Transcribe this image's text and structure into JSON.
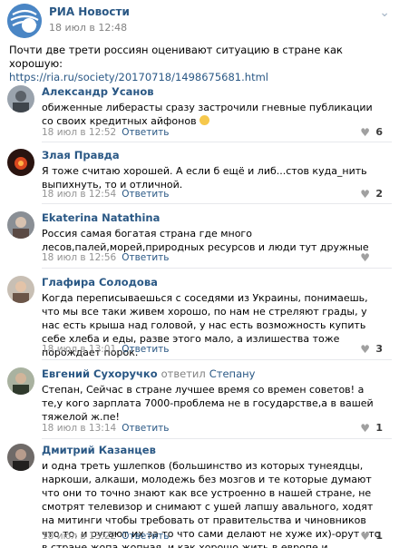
{
  "post": {
    "author": "РИА Новости",
    "date": "18 июл в 12:48",
    "text": "Почти две трети россиян оценивают ситуацию в стране как хорошую:",
    "link": "https://ria.ru/society/20170718/1498675681.html",
    "menu_icon": "chevron-down-icon"
  },
  "comments": [
    {
      "author": "Александр Усанов",
      "text": "обиженные либерасты сразу застрочили гневные публикации со своих кредитных айфонов",
      "date": "18 июл в 12:52",
      "reply_label": "Ответить",
      "likes": "6"
    },
    {
      "author": "Злая Правда",
      "text": "Я тоже считаю хорошей. А если б ещё и либ...стов куда_нить выпихнуть, то и отличной.",
      "date": "18 июл в 12:54",
      "reply_label": "Ответить",
      "likes": "2"
    },
    {
      "author": "Ekaterina Natathina",
      "text": "Россия самая богатая страна где много лесов,палей,морей,природных ресурсов и люди тут дружные",
      "date": "18 июл в 12:56",
      "reply_label": "Ответить",
      "likes": ""
    },
    {
      "author": "Глафира Солодова",
      "text": "Когда переписываешься с соседями из Украины, понимаешь, что мы все таки живем хорошо, по нам не стреляют грады, у нас есть крыша над головой, у нас есть возможность купить себе хлеба и еды, разве этого мало, а излишества тоже порождает порок.",
      "date": "18 июл в 13:01",
      "reply_label": "Ответить",
      "likes": "3"
    },
    {
      "author": "Евгений Сухоручко",
      "reply_to_label": "ответил",
      "reply_to_name": "Степану",
      "text": "Степан, Сейчас в стране лучшее время со времен советов! а те,у кого зарплата 7000-проблема не в государстве,а в вашей тяжелой ж.пе!",
      "date": "18 июл в 13:14",
      "reply_label": "Ответить",
      "likes": "1"
    },
    {
      "author": "Дмитрий Казанцев",
      "text": "и одна треть ушлепков (большинство из которых тунеядцы, наркоши, алкаши, молодежь без мозгов и те которые думают что они то точно знают как все устроенно в нашей стране, не смотрят телевизор и снимают с ушей лапшу авального, ходят на митинги чтобы требовать от правительства и чиновников что то, и ругают их за то что сами делают не хуже их)-орут что в стране жопа жопная, и как хорошо жить в европе и америке)))",
      "date": "18 июл в 13:22",
      "reply_label": "Ответить",
      "likes": "1"
    }
  ]
}
